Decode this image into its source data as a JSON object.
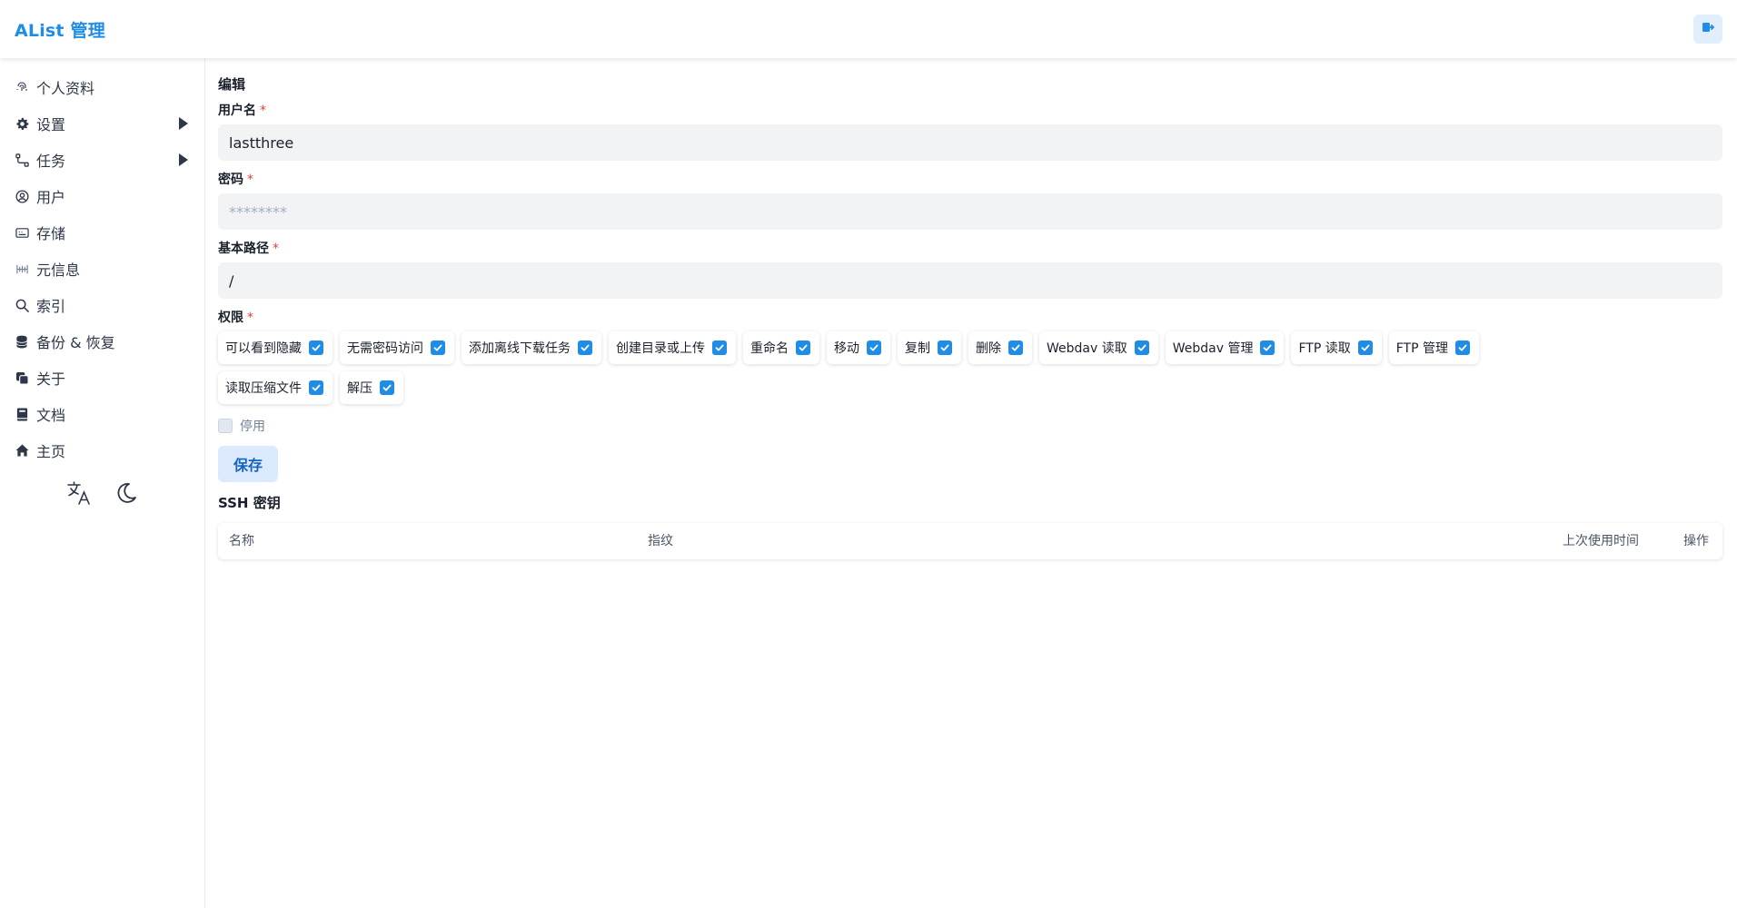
{
  "header": {
    "brand": "AList 管理",
    "logout_icon": "logout-icon"
  },
  "sidebar": {
    "items": [
      {
        "label": "个人资料",
        "icon": "fingerprint-icon",
        "expandable": false
      },
      {
        "label": "设置",
        "icon": "gear-icon",
        "expandable": true
      },
      {
        "label": "任务",
        "icon": "task-flow-icon",
        "expandable": true
      },
      {
        "label": "用户",
        "icon": "user-circle-icon",
        "expandable": false
      },
      {
        "label": "存储",
        "icon": "storage-icon",
        "expandable": false
      },
      {
        "label": "元信息",
        "icon": "meta-icon",
        "expandable": false
      },
      {
        "label": "索引",
        "icon": "search-icon",
        "expandable": false
      },
      {
        "label": "备份 & 恢复",
        "icon": "database-icon",
        "expandable": false
      },
      {
        "label": "关于",
        "icon": "copy-icon",
        "expandable": false
      },
      {
        "label": "文档",
        "icon": "book-icon",
        "expandable": false
      },
      {
        "label": "主页",
        "icon": "home-icon",
        "expandable": false
      }
    ],
    "tools": [
      "translate-icon",
      "moon-icon"
    ]
  },
  "form": {
    "title": "编辑",
    "username": {
      "label": "用户名",
      "required": "*",
      "value": "lastthree"
    },
    "password": {
      "label": "密码",
      "required": "*",
      "placeholder": "********"
    },
    "base_path": {
      "label": "基本路径",
      "required": "*",
      "value": "/"
    },
    "permissions": {
      "label": "权限",
      "required": "*",
      "items": [
        {
          "label": "可以看到隐藏",
          "checked": true
        },
        {
          "label": "无需密码访问",
          "checked": true
        },
        {
          "label": "添加离线下载任务",
          "checked": true
        },
        {
          "label": "创建目录或上传",
          "checked": true
        },
        {
          "label": "重命名",
          "checked": true
        },
        {
          "label": "移动",
          "checked": true
        },
        {
          "label": "复制",
          "checked": true
        },
        {
          "label": "删除",
          "checked": true
        },
        {
          "label": "Webdav 读取",
          "checked": true
        },
        {
          "label": "Webdav 管理",
          "checked": true
        },
        {
          "label": "FTP 读取",
          "checked": true
        },
        {
          "label": "FTP 管理",
          "checked": true
        },
        {
          "label": "读取压缩文件",
          "checked": true
        },
        {
          "label": "解压",
          "checked": true
        }
      ]
    },
    "disabled": {
      "label": "停用",
      "checked": false
    },
    "save_label": "保存"
  },
  "ssh": {
    "title": "SSH 密钥",
    "columns": [
      "名称",
      "指纹",
      "上次使用时间",
      "操作"
    ]
  },
  "colors": {
    "accent": "#1f8ce6",
    "input_bg": "#f1f3f5",
    "save_bg": "#dbeafe",
    "required": "#e53e3e"
  }
}
